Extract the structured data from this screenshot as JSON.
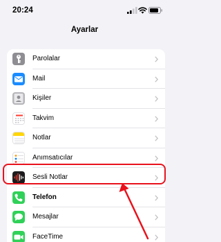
{
  "status_bar": {
    "time": "20:24"
  },
  "nav": {
    "title": "Ayarlar"
  },
  "rows": [
    {
      "label": "Parolalar",
      "icon": "key-icon",
      "color": "#8e8e93"
    },
    {
      "label": "Mail",
      "icon": "envelope-icon",
      "color": "#1a8cff"
    },
    {
      "label": "Kişiler",
      "icon": "contacts-icon",
      "color": "#a9a9ae"
    },
    {
      "label": "Takvim",
      "icon": "calendar-icon",
      "color": "#ffffff"
    },
    {
      "label": "Notlar",
      "icon": "notes-icon",
      "color": "#ffffff"
    },
    {
      "label": "Anımsatıcılar",
      "icon": "reminders-icon",
      "color": "#ffffff"
    },
    {
      "label": "Sesli Notlar",
      "icon": "voice-memo-icon",
      "color": "#1c1c1e"
    },
    {
      "label": "Telefon",
      "icon": "phone-icon",
      "color": "#30d158"
    },
    {
      "label": "Mesajlar",
      "icon": "messages-icon",
      "color": "#30d158"
    },
    {
      "label": "FaceTime",
      "icon": "facetime-icon",
      "color": "#30d158"
    }
  ],
  "annotation": {
    "highlight_color": "#e8121c"
  }
}
